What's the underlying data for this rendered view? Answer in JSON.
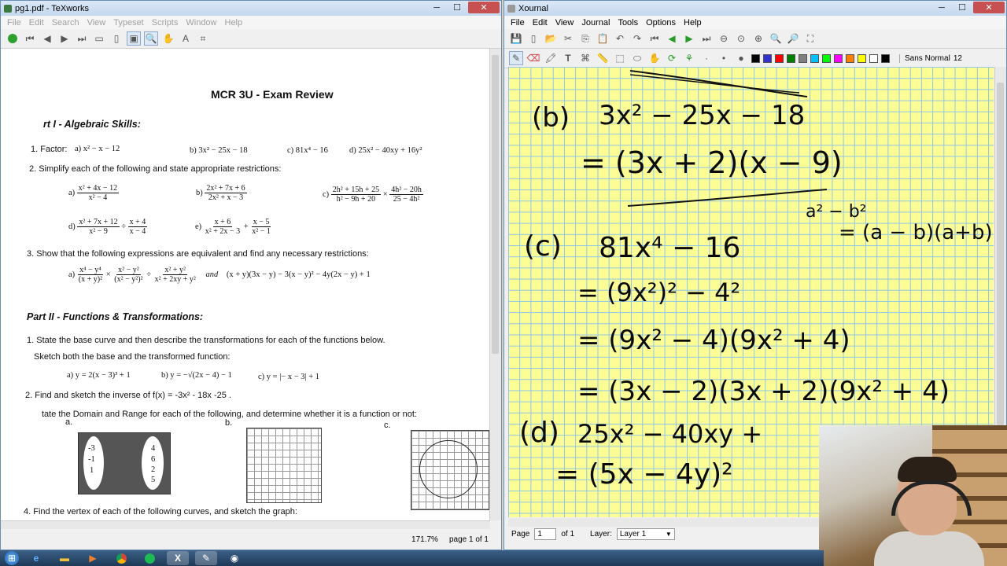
{
  "texworks": {
    "title": "pg1.pdf - TeXworks",
    "menu": [
      "File",
      "Edit",
      "Search",
      "View",
      "Typeset",
      "Scripts",
      "Window",
      "Help"
    ],
    "status": {
      "zoom": "171.7%",
      "page": "page 1 of 1"
    },
    "doc": {
      "title": "MCR 3U - Exam Review",
      "part1": "rt I - Algebraic Skills:",
      "q1_label": "1. Factor:",
      "q1_a": "a)  x² − x − 12",
      "q1_b": "b) 3x² − 25x − 18",
      "q1_c": "c) 81x⁴ − 16",
      "q1_d": "d)  25x² − 40xy + 16y²",
      "q2": "2.  Simplify each of the following and state appropriate restrictions:",
      "q2_a": {
        "label": "a)",
        "num": "x² + 4x − 12",
        "den": "x² − 4"
      },
      "q2_b": {
        "label": "b)",
        "num": "2x² + 7x + 6",
        "den": "2x² + x − 3"
      },
      "q2_c": {
        "label": "c)",
        "num1": "2h² + 15h + 25",
        "den1": "h² − 9h + 20",
        "op": "×",
        "num2": "4h² − 20h",
        "den2": "25 − 4h²"
      },
      "q2_d": {
        "label": "d)",
        "num1": "x² + 7x + 12",
        "den1": "x² − 9",
        "op": "÷",
        "num2": "x + 4",
        "den2": "x − 4"
      },
      "q2_e": {
        "label": "e)",
        "num1": "x + 6",
        "den1": "x² + 2x − 3",
        "op": "+",
        "num2": "x − 5",
        "den2": "x² − 1"
      },
      "q3": "3.  Show that the following expressions are equivalent and find any necessary restrictions:",
      "q3_a": {
        "label": "a)",
        "num1": "x⁴ − y⁴",
        "den1": "(x + y)²",
        "op1": "×",
        "num2": "x² − y²",
        "den2": "(x² − y²)²",
        "op2": "÷",
        "num3": "x² + y²",
        "den3": "x² + 2xy + y²",
        "and": "and",
        "rhs": "(x + y)(3x − y) − 3(x − y)² − 4y(2x − y) + 1"
      },
      "part2": "Part II - Functions & Transformations:",
      "p2_q1": "1. State the base curve and then describe the transformations for each of the functions below.",
      "p2_q1b": "Sketch both the base and the transformed function:",
      "p2_q1_a": "a)   y = 2(x − 3)³ + 1",
      "p2_q1_b": "b)   y = −√(2x − 4) − 1",
      "p2_q1_c": "c)   y = |− x − 3| + 1",
      "p2_q2": "2. Find and sketch the inverse of  f(x) = -3x² - 18x -25 .",
      "p2_q3": "tate the Domain and Range for each of the following, and determine whether it is a function or not:",
      "p2_q3_labels": [
        "a.",
        "b.",
        "c."
      ],
      "mapping_left": [
        "-3",
        "-1",
        "1"
      ],
      "mapping_right": [
        "4",
        "6",
        "2",
        "5"
      ],
      "p2_q4": "4.  Find the vertex of each of the following curves, and sketch the graph:"
    }
  },
  "xournal": {
    "title": "Xournal",
    "menu": [
      "File",
      "Edit",
      "View",
      "Journal",
      "Tools",
      "Options",
      "Help"
    ],
    "font": "Sans Normal",
    "font_size": "12",
    "colors": [
      "#000000",
      "#3333cc",
      "#ff0000",
      "#008000",
      "#808080",
      "#00c0ff",
      "#00ff00",
      "#ff00ff",
      "#ff8000",
      "#ffff00",
      "#ffffff",
      "#000000"
    ],
    "status": {
      "page_label": "Page",
      "page_value": "1",
      "of": "of 1",
      "layer_label": "Layer:",
      "layer_value": "Layer 1"
    },
    "ink": {
      "b_label": "(b)",
      "b_expr": "3x² − 25x − 18",
      "b_ans": "= (3x + 2)(x − 9)",
      "note1": "a² − b²",
      "note2": "= (a − b)(a+b)",
      "c_label": "(c)",
      "c_expr": "81x⁴ − 16",
      "c_step1": "= (9x²)² − 4²",
      "c_step2": "= (9x² − 4)(9x² + 4)",
      "c_step3": "= (3x − 2)(3x + 2)(9x² + 4)",
      "d_label": "(d)",
      "d_expr": "25x² − 40xy +",
      "d_ans": "= (5x − 4y)²"
    }
  },
  "taskbar": {
    "icons": [
      "windows-start-icon",
      "ie-icon",
      "explorer-icon",
      "media-icon",
      "chrome-icon",
      "spotify-icon",
      "texworks-icon",
      "xournal-icon",
      "obs-icon"
    ]
  }
}
